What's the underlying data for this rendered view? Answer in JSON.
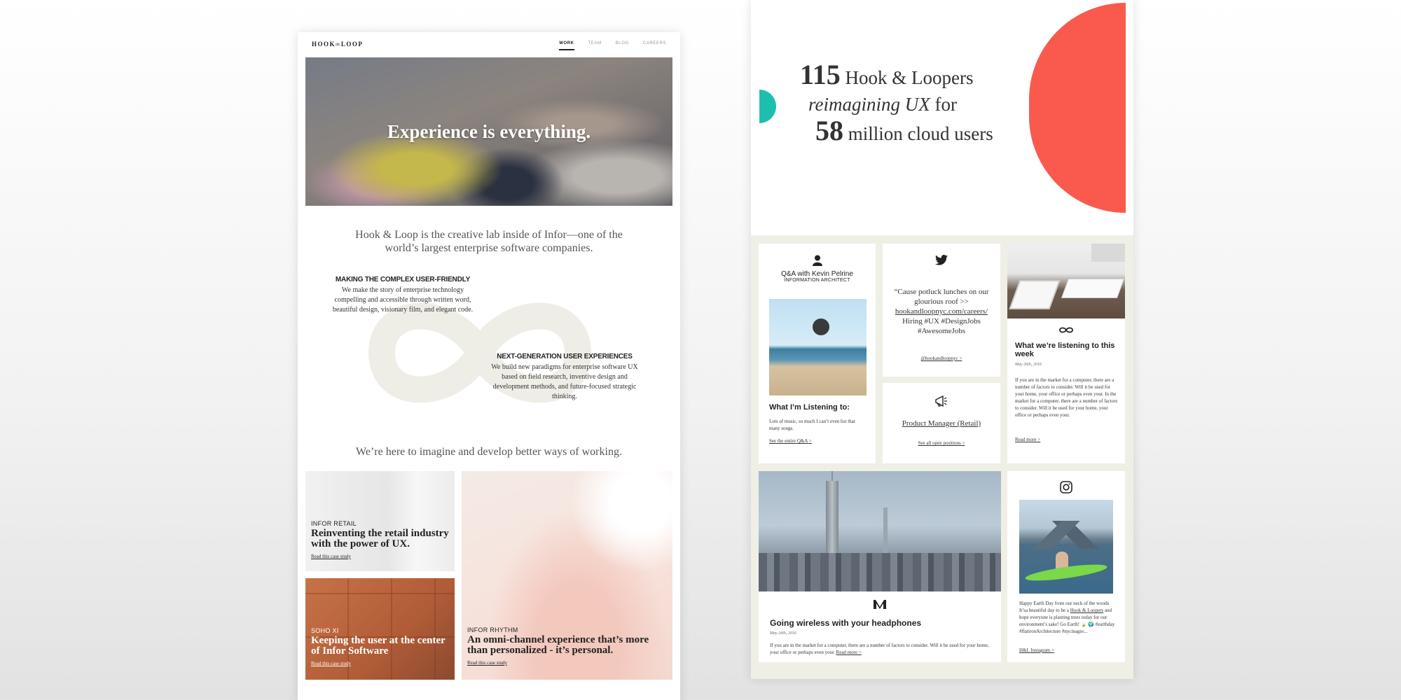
{
  "left": {
    "logo": "HOOK∞LOOP",
    "nav": [
      {
        "label": "WORK",
        "active": true
      },
      {
        "label": "TEAM",
        "active": false
      },
      {
        "label": "BLOG",
        "active": false
      },
      {
        "label": "CAREERS",
        "active": false
      }
    ],
    "hero_title": "Experience is everything.",
    "intro": "Hook & Loop is the creative lab inside of Infor—one of the world’s largest enterprise software companies.",
    "features": [
      {
        "title": "MAKING THE COMPLEX USER-FRIENDLY",
        "body": "We make the story of enterprise technology compelling and accessible through written word, beautiful design, visionary film, and elegant code."
      },
      {
        "title": "NEXT-GENERATION USER EXPERIENCES",
        "body": "We build new paradigms for enterprise software UX based on field research, inventive design and development methods, and future-focused strategic thinking."
      }
    ],
    "tagline": "We’re here to imagine and develop better ways of working.",
    "cases": [
      {
        "category": "INFOR RETAIL",
        "title": "Reinventing the retail industry with the power of UX.",
        "link": "Read this case study"
      },
      {
        "category": "SOHO XI",
        "title": "Keeping the user at the center of Infor Software",
        "link": "Read this case study"
      },
      {
        "category": "INFOR RHYTHM",
        "title": "An omni-channel experience that’s more than personalized - it’s personal.",
        "link": "Read this case study"
      }
    ]
  },
  "right": {
    "stats": {
      "num1": "115",
      "line1_text": "Hook & Loopers",
      "line2_italic": "reimagining UX",
      "line2_text": "for",
      "num2": "58",
      "line3_text": "million cloud users",
      "colors": {
        "teal": "#1fbfb0",
        "coral": "#f95a4d"
      }
    },
    "qa_card": {
      "icon": "person-icon",
      "name": "Q&A with Kevin Pelrine",
      "role": "INFORMATION ARCHITECT",
      "section_title": "What I’m Listening to:",
      "body": "Lots of music, so much I can’t even list that many songs.",
      "link": "See the entire Q&A >"
    },
    "twitter_card": {
      "icon": "twitter-icon",
      "tweet_prefix": "“Cause potluck lunches on our glourious roof >>",
      "tweet_url": "hookandloopnyc.com/careers/",
      "tweet_suffix": "Hiring #UX #DesignJobs #AwesomeJobs",
      "link": "@hookandloopnyc >"
    },
    "job_card": {
      "icon": "megaphone-icon",
      "title": "Product Manager (Retail)",
      "link": "See all open positions >"
    },
    "blog_card": {
      "icon": "infinity-icon",
      "title": "What we’re listening to this week",
      "date": "May 26th, 2016",
      "body": "If you are in the market for a computer, there are a number of factors to consider. Will it be used for your home, your office or perhaps even your. In the market for a computer, there are a number of factors to consider. Will it be used for your home, your office or perhaps even your.",
      "link": "Read more >"
    },
    "wireless_card": {
      "icon": "medium-icon",
      "title": "Going wireless with your headphones",
      "date": "May 26th, 2016",
      "body": "If you are in the market for a computer, there are a number of factors to consider. Will it be used for your home, your office or perhaps even your.",
      "link": "Read more >"
    },
    "insta_card": {
      "icon": "instagram-icon",
      "body_prefix": "Happy Earth Day from our neck of the woods It’sa beautiful day to be a",
      "body_link": "Hook & Loopers",
      "body_suffix": "and hope everyone is planting trees today for our environment’s sake! Go Earth! 🍃 🌍 #earthday #flatironArchitecture #nycinagre...",
      "link": "H&L Instagram >"
    }
  }
}
